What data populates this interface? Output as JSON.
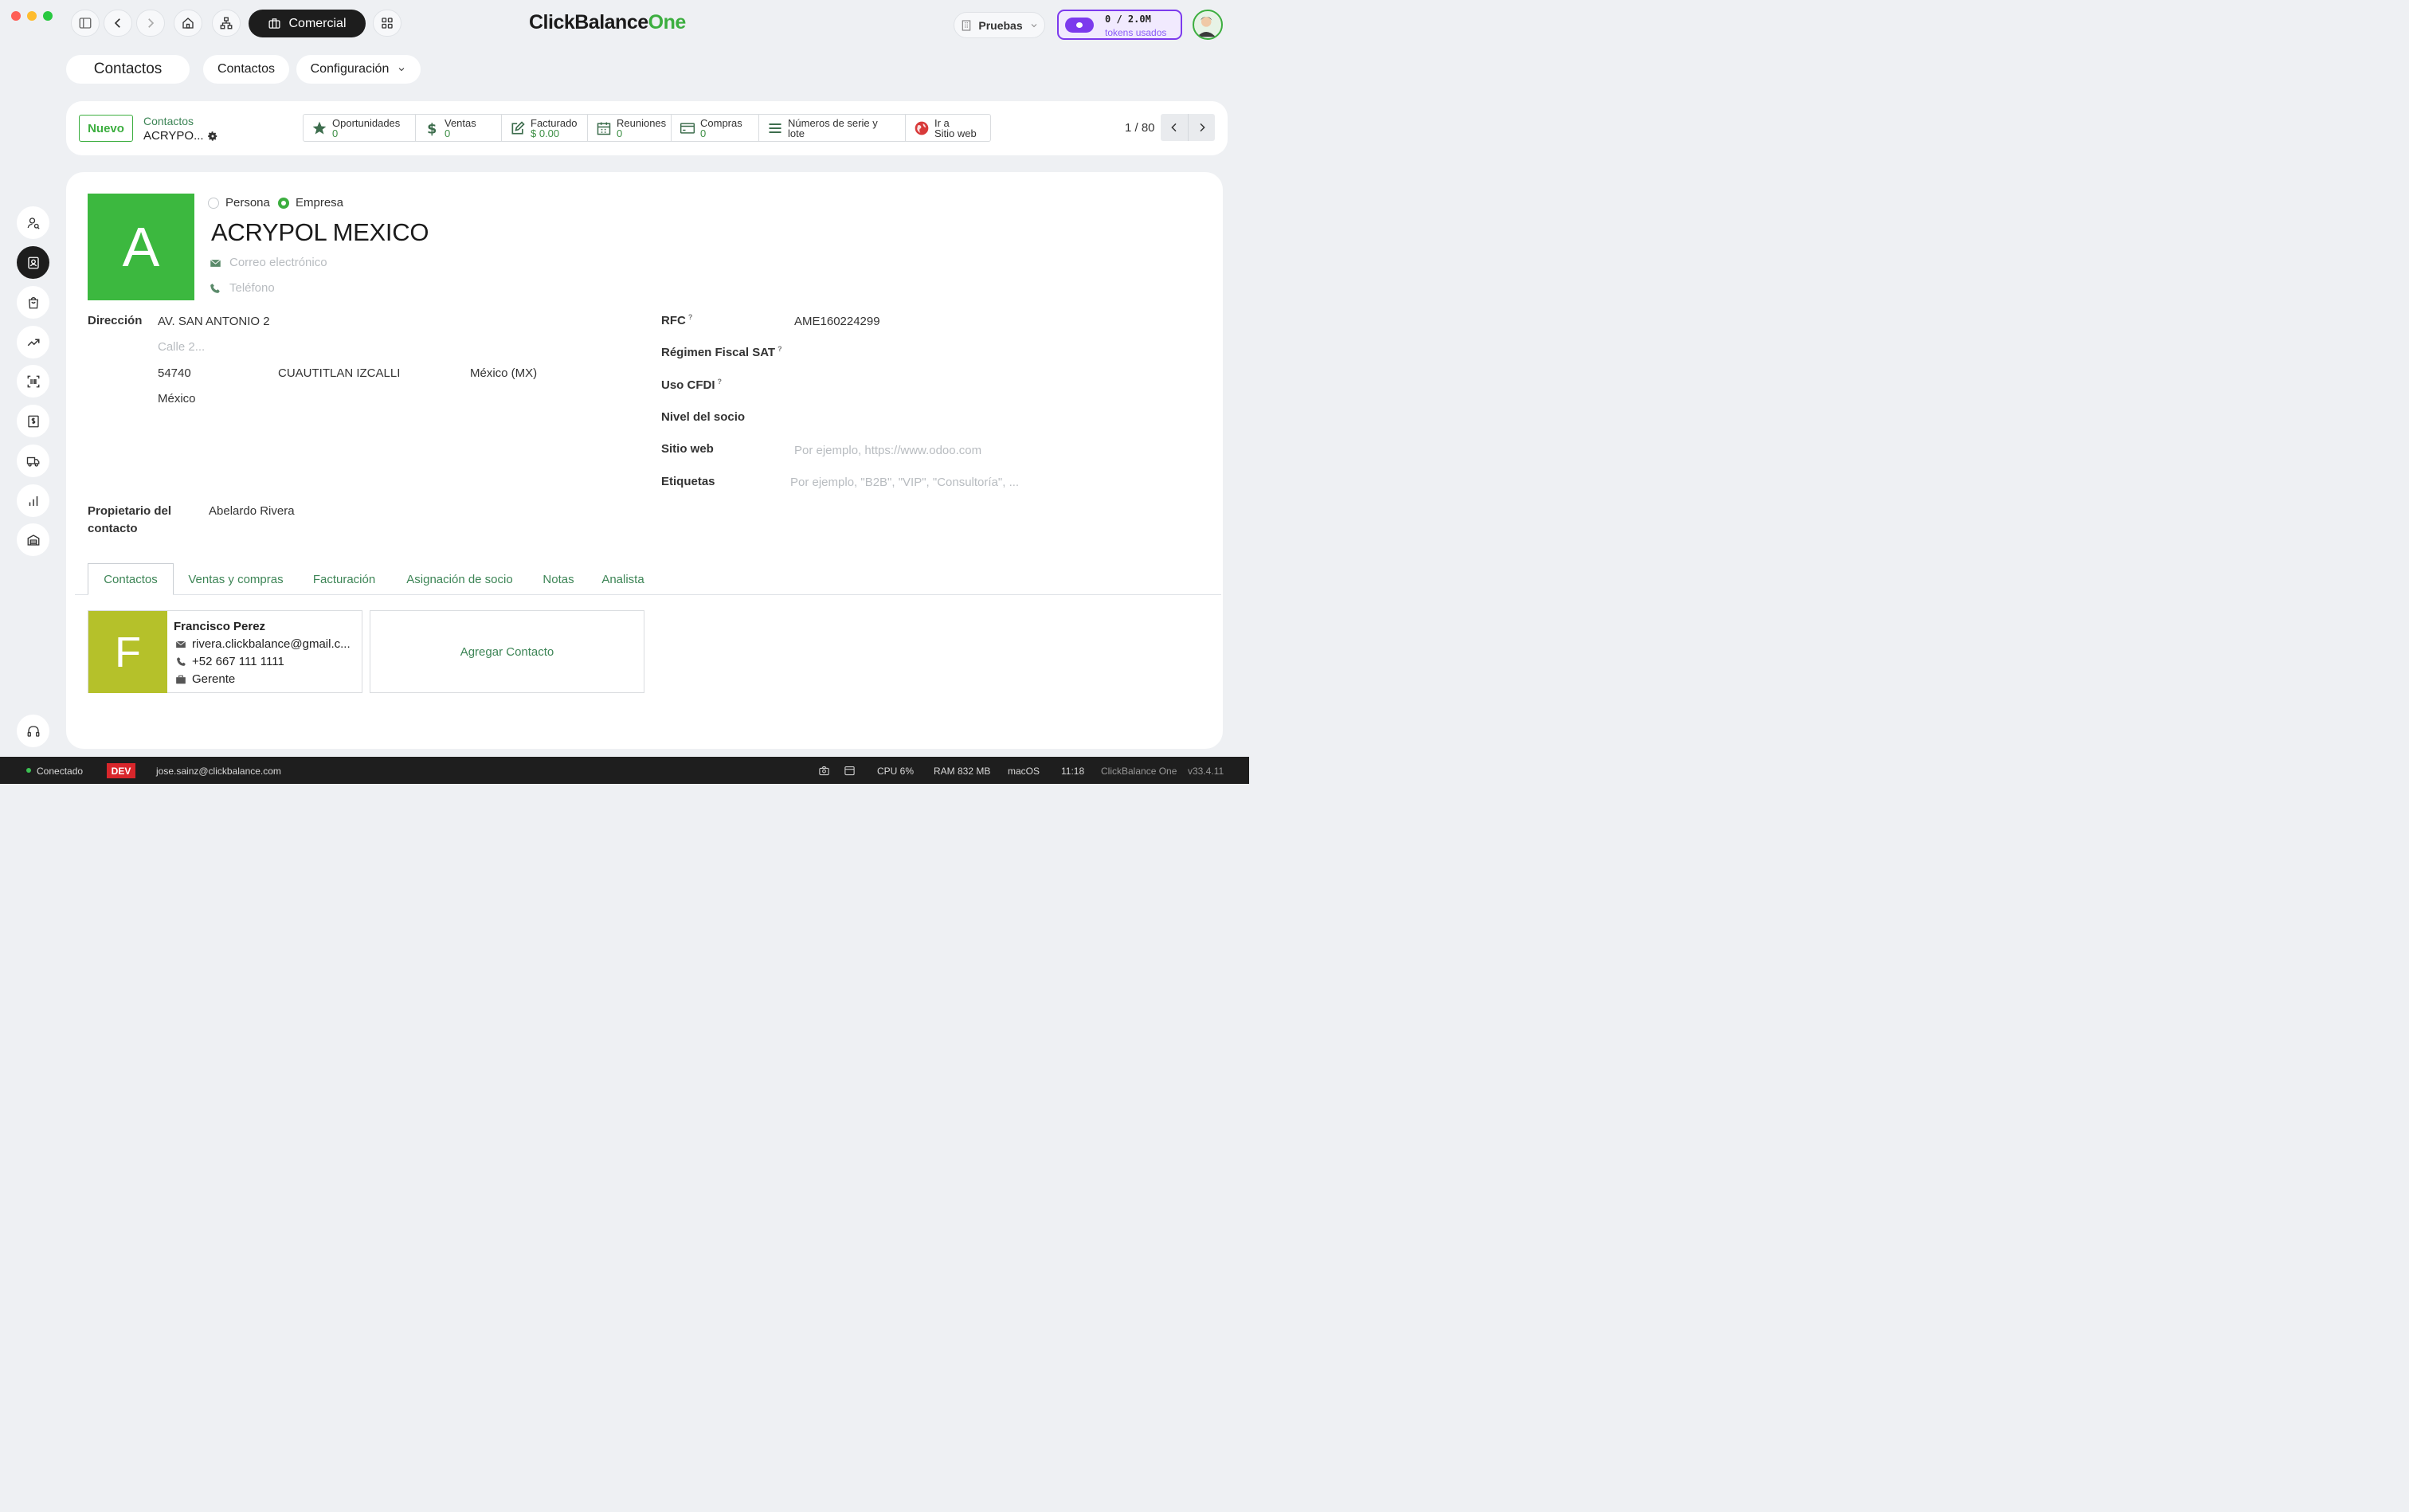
{
  "window": {
    "app_title_main": "ClickBalance",
    "app_title_accent": "One",
    "module_button": "Comercial"
  },
  "header_right": {
    "company_label": "Pruebas",
    "tokens_count": "0 / 2.0M",
    "tokens_label": "tokens usados"
  },
  "topnav": {
    "title": "Contactos",
    "contacts_label": "Contactos",
    "config_label": "Configuración"
  },
  "actionbar": {
    "new_label": "Nuevo",
    "breadcrumb_parent": "Contactos",
    "breadcrumb_current": "ACRYPO...",
    "pager": "1 / 80",
    "stats": [
      {
        "label": "Oportunidades",
        "value": "0",
        "icon": "star-icon"
      },
      {
        "label": "Ventas",
        "value": "0",
        "icon": "dollar-icon"
      },
      {
        "label": "Facturado",
        "value": "$ 0.00",
        "icon": "invoice-icon"
      },
      {
        "label": "Reuniones",
        "value": "0",
        "icon": "calendar-icon"
      },
      {
        "label": "Compras",
        "value": "0",
        "icon": "credit-card-icon"
      },
      {
        "label": "Números de serie y lote",
        "value": "",
        "icon": "list-icon"
      },
      {
        "label": "Ir a",
        "value": "Sitio web",
        "icon": "globe-icon"
      }
    ]
  },
  "record": {
    "avatar_letter": "A",
    "avatar_color": "#3cb83f",
    "type_person": "Persona",
    "type_company": "Empresa",
    "selected_type": "Empresa",
    "name": "ACRYPOL MEXICO",
    "email_placeholder": "Correo electrónico",
    "phone_placeholder": "Teléfono",
    "address": {
      "label": "Dirección",
      "street": "AV. SAN ANTONIO 2",
      "street2_placeholder": "Calle 2...",
      "zip": "54740",
      "city": "CUAUTITLAN IZCALLI",
      "state": "México (MX)",
      "country": "México"
    },
    "owner": {
      "label": "Propietario del contacto",
      "value": "Abelardo Rivera"
    },
    "right_fields": {
      "rfc_label": "RFC",
      "rfc_value": "AME160224299",
      "regimen_label": "Régimen Fiscal SAT",
      "uso_cfdi_label": "Uso CFDI",
      "nivel_label": "Nivel del socio",
      "website_label": "Sitio web",
      "website_placeholder": "Por ejemplo, https://www.odoo.com",
      "tags_label": "Etiquetas",
      "tags_placeholder": "Por ejemplo, \"B2B\", \"VIP\", \"Consultoría\", ...",
      "help_mark": "?"
    }
  },
  "tabs": [
    "Contactos",
    "Ventas y compras",
    "Facturación",
    "Asignación de socio",
    "Notas",
    "Analista"
  ],
  "active_tab": "Contactos",
  "contact_card": {
    "letter": "F",
    "color": "#b5c12a",
    "name": "Francisco Perez",
    "email": "rivera.clickbalance@gmail.c...",
    "phone": "+52 667 111 1111",
    "role": "Gerente"
  },
  "add_contact_label": "Agregar Contacto",
  "statusbar": {
    "connection": "Conectado",
    "env_badge": "DEV",
    "user_email": "jose.sainz@clickbalance.com",
    "cpu": "CPU 6%",
    "ram": "RAM 832 MB",
    "os": "macOS",
    "time": "11:18",
    "app": "ClickBalance One",
    "version": "v33.4.11"
  },
  "colors": {
    "accent_green": "#3cae3f",
    "link_green": "#3d8556",
    "token_purple": "#7c3aed"
  }
}
